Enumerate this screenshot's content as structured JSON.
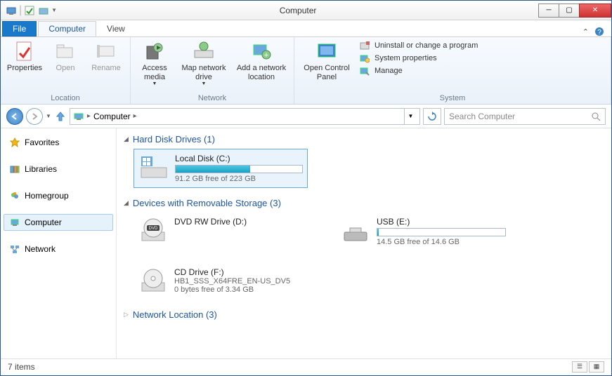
{
  "window": {
    "title": "Computer"
  },
  "menu": {
    "file": "File"
  },
  "tabs": {
    "computer": "Computer",
    "view": "View"
  },
  "ribbon": {
    "location": {
      "label": "Location",
      "properties": "Properties",
      "open": "Open",
      "rename": "Rename"
    },
    "network": {
      "label": "Network",
      "access_media": "Access media",
      "map_drive": "Map network drive",
      "add_location": "Add a network location"
    },
    "system": {
      "label": "System",
      "open_cp": "Open Control Panel",
      "uninstall": "Uninstall or change a program",
      "sysprops": "System properties",
      "manage": "Manage"
    }
  },
  "address": {
    "root": "Computer"
  },
  "search": {
    "placeholder": "Search Computer"
  },
  "nav": {
    "favorites": "Favorites",
    "libraries": "Libraries",
    "homegroup": "Homegroup",
    "computer": "Computer",
    "network": "Network"
  },
  "groups": {
    "hdd": {
      "title": "Hard Disk Drives (1)"
    },
    "removable": {
      "title": "Devices with Removable Storage (3)"
    },
    "netloc": {
      "title": "Network Location (3)"
    }
  },
  "drives": {
    "c": {
      "name": "Local Disk (C:)",
      "free": "91.2 GB free of 223 GB",
      "pct": 59
    },
    "d": {
      "name": "DVD RW Drive (D:)"
    },
    "e": {
      "name": "USB (E:)",
      "free": "14.5 GB free of 14.6 GB",
      "pct": 1
    },
    "f": {
      "name": "CD Drive (F:)",
      "sub": "HB1_SSS_X64FRE_EN-US_DV5",
      "free": "0 bytes free of 3.34 GB"
    }
  },
  "status": {
    "items": "7 items"
  }
}
